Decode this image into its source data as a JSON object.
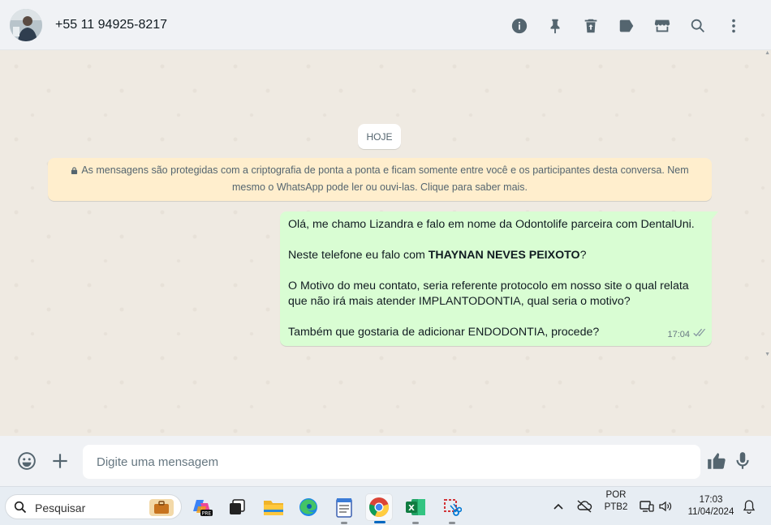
{
  "header": {
    "contact_name": "+55 11 94925-8217",
    "icons": [
      "info-icon",
      "pin-icon",
      "delete-icon",
      "label-icon",
      "catalog-icon",
      "search-icon",
      "menu-icon"
    ]
  },
  "chat": {
    "date_chip": "HOJE",
    "encryption_notice": "As mensagens são protegidas com a criptografia de ponta a ponta e ficam somente entre você e os participantes desta conversa. Nem mesmo o WhatsApp pode ler ou ouvi-las. Clique para saber mais.",
    "message": {
      "line1": "Olá, me chamo Lizandra e falo em nome da Odontolife parceira com DentalUni.",
      "line2_prefix": "Neste telefone eu falo com ",
      "line2_bold": "THAYNAN NEVES PEIXOTO",
      "line2_suffix": "?",
      "line3": "O Motivo do meu contato, seria referente protocolo em nosso site o qual relata que não irá mais atender IMPLANTODONTIA, qual seria o motivo?",
      "line4": "Também que gostaria de adicionar ENDODONTIA, procede?",
      "time": "17:04",
      "status": "delivered-double-check"
    }
  },
  "composer": {
    "placeholder": "Digite uma mensagem"
  },
  "taskbar": {
    "search_label": "Pesquisar",
    "apps": [
      "copilot-pre",
      "task-view",
      "file-explorer",
      "edge",
      "notepad",
      "chrome",
      "excel",
      "snipping-tool"
    ],
    "active_app": "chrome",
    "language_line1": "POR",
    "language_line2": "PTB2",
    "time": "17:03",
    "date": "11/04/2024"
  },
  "colors": {
    "header_bg": "#f0f2f5",
    "chat_bg": "#efeae2",
    "outgoing_bubble": "#d9fdd3",
    "system_notice": "#ffeecd",
    "icon_gray": "#54656f"
  }
}
